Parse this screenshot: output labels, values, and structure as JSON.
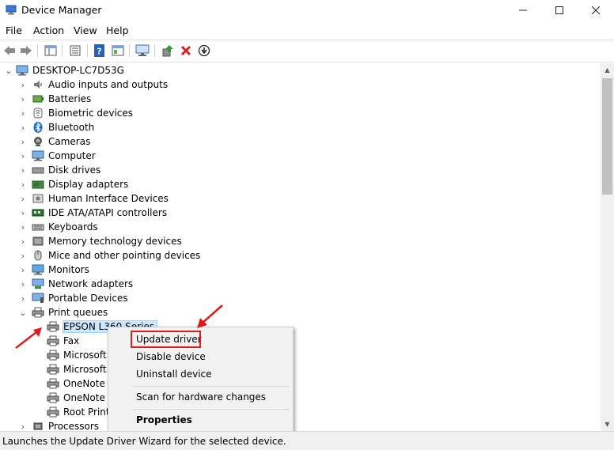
{
  "window": {
    "title": "Device Manager",
    "minimize": "—",
    "maximize": "☐",
    "close": "✕"
  },
  "menu": [
    "File",
    "Action",
    "View",
    "Help"
  ],
  "toolbar": [
    "back",
    "forward",
    "properties-list",
    "properties",
    "help",
    "details",
    "monitor",
    "update-driver",
    "uninstall",
    "download"
  ],
  "tree": {
    "root": "DESKTOP-LC7D53G",
    "categories": [
      {
        "label": "Audio inputs and outputs",
        "icon": "speaker-icon"
      },
      {
        "label": "Batteries",
        "icon": "battery-icon"
      },
      {
        "label": "Biometric devices",
        "icon": "fingerprint-icon"
      },
      {
        "label": "Bluetooth",
        "icon": "bluetooth-icon"
      },
      {
        "label": "Cameras",
        "icon": "camera-icon"
      },
      {
        "label": "Computer",
        "icon": "computer-icon"
      },
      {
        "label": "Disk drives",
        "icon": "disk-icon"
      },
      {
        "label": "Display adapters",
        "icon": "display-adapter-icon"
      },
      {
        "label": "Human Interface Devices",
        "icon": "hid-icon"
      },
      {
        "label": "IDE ATA/ATAPI controllers",
        "icon": "ide-icon"
      },
      {
        "label": "Keyboards",
        "icon": "keyboard-icon"
      },
      {
        "label": "Memory technology devices",
        "icon": "memory-icon"
      },
      {
        "label": "Mice and other pointing devices",
        "icon": "mouse-icon"
      },
      {
        "label": "Monitors",
        "icon": "monitor-icon"
      },
      {
        "label": "Network adapters",
        "icon": "network-icon"
      },
      {
        "label": "Portable Devices",
        "icon": "portable-icon"
      },
      {
        "label": "Print queues",
        "icon": "printer-icon"
      }
    ],
    "print_children": [
      "EPSON L360 Series",
      "Fax",
      "Microsoft",
      "Microsoft",
      "OneNote (",
      "OneNote f",
      "Root Print"
    ],
    "after": "Processors"
  },
  "context_menu": {
    "update_driver": "Update driver",
    "disable_device": "Disable device",
    "uninstall_device": "Uninstall device",
    "scan_hardware": "Scan for hardware changes",
    "properties": "Properties"
  },
  "status": "Launches the Update Driver Wizard for the selected device.",
  "colors": {
    "selection": "#cce8ff",
    "annotation": "#e01b1b",
    "accent": "#0078d7"
  }
}
